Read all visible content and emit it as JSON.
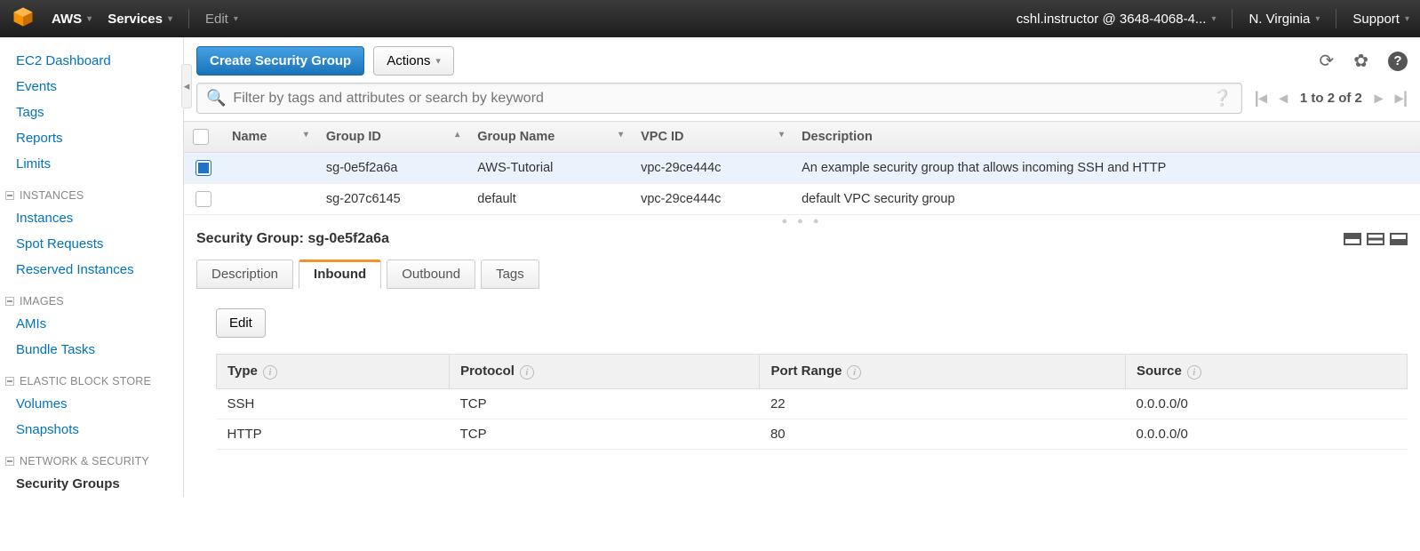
{
  "topbar": {
    "brand": "AWS",
    "services": "Services",
    "edit": "Edit",
    "account": "cshl.instructor @ 3648-4068-4...",
    "region": "N. Virginia",
    "support": "Support"
  },
  "sidebar": {
    "top": [
      {
        "label": "EC2 Dashboard"
      },
      {
        "label": "Events"
      },
      {
        "label": "Tags"
      },
      {
        "label": "Reports"
      },
      {
        "label": "Limits"
      }
    ],
    "groups": [
      {
        "title": "INSTANCES",
        "items": [
          {
            "label": "Instances"
          },
          {
            "label": "Spot Requests"
          },
          {
            "label": "Reserved Instances"
          }
        ]
      },
      {
        "title": "IMAGES",
        "items": [
          {
            "label": "AMIs"
          },
          {
            "label": "Bundle Tasks"
          }
        ]
      },
      {
        "title": "ELASTIC BLOCK STORE",
        "items": [
          {
            "label": "Volumes"
          },
          {
            "label": "Snapshots"
          }
        ]
      },
      {
        "title": "NETWORK & SECURITY",
        "items": [
          {
            "label": "Security Groups",
            "active": true
          }
        ]
      }
    ]
  },
  "toolbar": {
    "create": "Create Security Group",
    "actions": "Actions"
  },
  "filter": {
    "placeholder": "Filter by tags and attributes or search by keyword",
    "page_info": "1 to 2 of 2"
  },
  "table": {
    "columns": [
      "Name",
      "Group ID",
      "Group Name",
      "VPC ID",
      "Description"
    ],
    "rows": [
      {
        "selected": true,
        "name": "",
        "group_id": "sg-0e5f2a6a",
        "group_name": "AWS-Tutorial",
        "vpc_id": "vpc-29ce444c",
        "description": "An example security group that allows incoming SSH and HTTP"
      },
      {
        "selected": false,
        "name": "",
        "group_id": "sg-207c6145",
        "group_name": "default",
        "vpc_id": "vpc-29ce444c",
        "description": "default VPC security group"
      }
    ]
  },
  "detail": {
    "title_prefix": "Security Group: ",
    "title_id": "sg-0e5f2a6a",
    "tabs": [
      "Description",
      "Inbound",
      "Outbound",
      "Tags"
    ],
    "active_tab": "Inbound",
    "edit": "Edit",
    "rule_columns": [
      "Type",
      "Protocol",
      "Port Range",
      "Source"
    ],
    "rules": [
      {
        "type": "SSH",
        "protocol": "TCP",
        "port": "22",
        "source": "0.0.0.0/0"
      },
      {
        "type": "HTTP",
        "protocol": "TCP",
        "port": "80",
        "source": "0.0.0.0/0"
      }
    ]
  }
}
